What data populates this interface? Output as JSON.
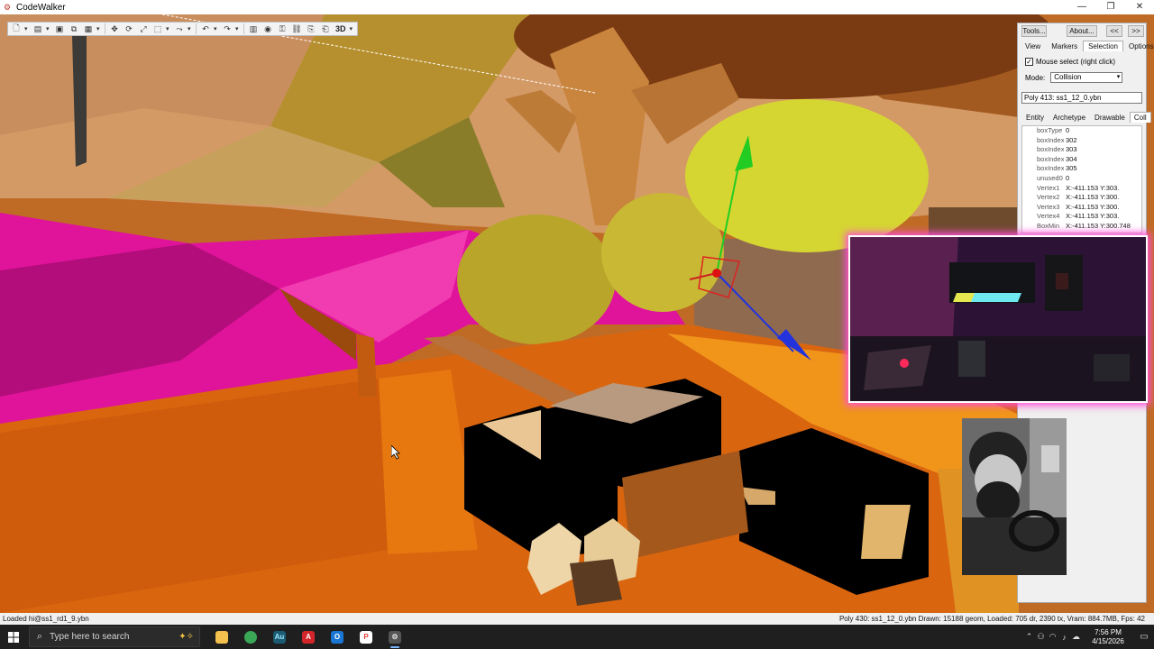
{
  "window": {
    "title": "CodeWalker",
    "minimize": "—",
    "restore": "❐",
    "close": "✕"
  },
  "toolbar": {
    "view_mode_label": "3D",
    "icons": [
      "new-icon",
      "open-icon",
      "save-icon",
      "save-all-icon",
      "move-icon",
      "rotate-icon",
      "scale-icon",
      "select-box-icon",
      "undo-icon",
      "redo-icon",
      "grid-icon",
      "snap-icon",
      "camera-icon"
    ]
  },
  "panel": {
    "tools_label": "Tools...",
    "about_label": "About...",
    "prev_label": "<<",
    "next_label": ">>",
    "tabs": [
      "View",
      "Markers",
      "Selection",
      "Options"
    ],
    "active_tab": "Selection",
    "mouse_select_label": "Mouse select (right click)",
    "mouse_select_checked": true,
    "mode_label": "Mode:",
    "mode_value": "Collision",
    "selection_text": "Poly 413: ss1_12_0.ybn",
    "subtabs": [
      "Entity",
      "Archetype",
      "Drawable",
      "Coll"
    ],
    "active_subtab": "Coll",
    "properties": [
      {
        "name": "boxType",
        "value": "0"
      },
      {
        "name": "boxIndex1",
        "value": "302"
      },
      {
        "name": "boxIndex2",
        "value": "303"
      },
      {
        "name": "boxIndex3",
        "value": "304"
      },
      {
        "name": "boxIndex4",
        "value": "305"
      },
      {
        "name": "unused0",
        "value": "0"
      },
      {
        "name": "Vertex1",
        "value": "X:-411.153 Y:303."
      },
      {
        "name": "Vertex2",
        "value": "X:-411.153 Y:300."
      },
      {
        "name": "Vertex3",
        "value": "X:-411.153 Y:300."
      },
      {
        "name": "Vertex4",
        "value": "X:-411.153 Y:303."
      },
      {
        "name": "BoxMin",
        "value": "X:-411.153 Y:300.748"
      }
    ]
  },
  "statusbar": {
    "left": "Loaded hi@ss1_rd1_9.ybn",
    "right": "Poly 430: ss1_12_0.ybn  Drawn: 15188 geom, Loaded: 705 dr, 2390 tx, Vram: 884.7MB, Fps: 42"
  },
  "taskbar": {
    "search_placeholder": "Type here to search",
    "time": "7:56 PM",
    "date": "4/15/2026",
    "apps": [
      {
        "name": "file-explorer-icon",
        "color": "#f2c14e",
        "glyph": ""
      },
      {
        "name": "chrome-icon",
        "color": "#3aa757",
        "glyph": ""
      },
      {
        "name": "audition-icon",
        "color": "#1b5b73",
        "glyph": "Au"
      },
      {
        "name": "acrobat-icon",
        "color": "#d4252a",
        "glyph": "A"
      },
      {
        "name": "outlook-icon",
        "color": "#1976d2",
        "glyph": "O"
      },
      {
        "name": "pdf-app-icon",
        "color": "#e53935",
        "glyph": "P"
      },
      {
        "name": "codewalker-icon",
        "color": "#b0b0b0",
        "glyph": "⚙"
      }
    ],
    "active_app": "codewalker-icon"
  },
  "colors": {
    "magenta_wall": "#e0139b",
    "orange_floor": "#d9650f",
    "olive_sphere": "#b9a52a",
    "yellow_sphere": "#d6d632",
    "webcam_glow": "#ff4fd8"
  }
}
